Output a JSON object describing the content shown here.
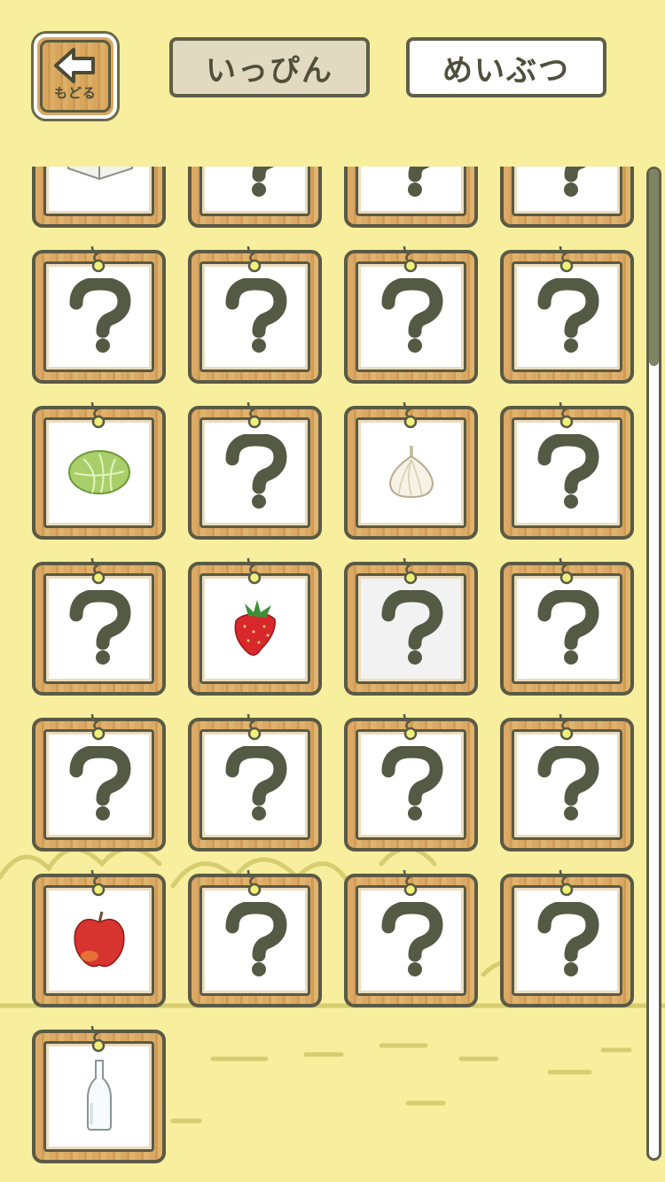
{
  "header": {
    "back_label": "もどる",
    "tabs": [
      {
        "label": "いっぴん",
        "selected": true
      },
      {
        "label": "めいぶつ",
        "selected": false
      }
    ]
  },
  "colors": {
    "background": "#f7ee9e",
    "frame_dark": "#5a5a44",
    "question_mark": "#555a44",
    "scroll_thumb": "#7e8462"
  },
  "cards": [
    {
      "item": "box",
      "icon": "box-icon"
    },
    {
      "item": "unknown",
      "icon": "question-icon"
    },
    {
      "item": "unknown",
      "icon": "question-icon"
    },
    {
      "item": "unknown",
      "icon": "question-icon"
    },
    {
      "item": "unknown",
      "icon": "question-icon"
    },
    {
      "item": "unknown",
      "icon": "question-icon"
    },
    {
      "item": "unknown",
      "icon": "question-icon"
    },
    {
      "item": "unknown",
      "icon": "question-icon"
    },
    {
      "item": "cabbage",
      "icon": "cabbage-icon"
    },
    {
      "item": "unknown",
      "icon": "question-icon"
    },
    {
      "item": "garlic",
      "icon": "garlic-icon"
    },
    {
      "item": "unknown",
      "icon": "question-icon"
    },
    {
      "item": "unknown",
      "icon": "question-icon"
    },
    {
      "item": "strawberry",
      "icon": "strawberry-icon"
    },
    {
      "item": "unknown",
      "icon": "question-icon",
      "selected": true
    },
    {
      "item": "unknown",
      "icon": "question-icon"
    },
    {
      "item": "unknown",
      "icon": "question-icon"
    },
    {
      "item": "unknown",
      "icon": "question-icon"
    },
    {
      "item": "unknown",
      "icon": "question-icon"
    },
    {
      "item": "unknown",
      "icon": "question-icon"
    },
    {
      "item": "apple",
      "icon": "apple-icon"
    },
    {
      "item": "unknown",
      "icon": "question-icon"
    },
    {
      "item": "unknown",
      "icon": "question-icon"
    },
    {
      "item": "unknown",
      "icon": "question-icon"
    },
    {
      "item": "bottle",
      "icon": "bottle-icon"
    }
  ],
  "scroll": {
    "position_fraction": 0.0
  }
}
